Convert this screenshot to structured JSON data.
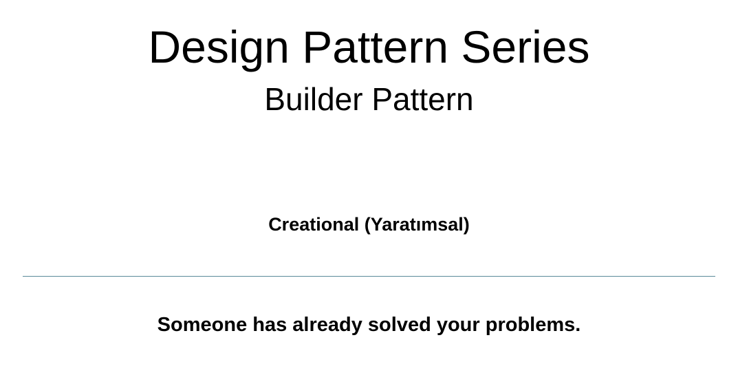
{
  "slide": {
    "title": "Design Pattern Series",
    "subtitle": "Builder Pattern",
    "category": "Creational (Yaratımsal)",
    "tagline": "Someone has already solved your problems.",
    "divider_color": "#5a8a99"
  }
}
